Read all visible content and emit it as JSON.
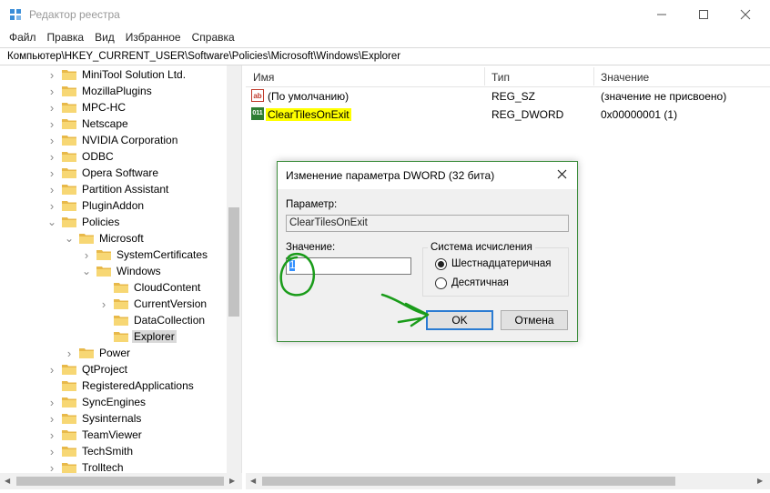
{
  "window": {
    "title": "Редактор реестра",
    "minimize_icon": "minimize-icon",
    "maximize_icon": "maximize-icon",
    "close_icon": "close-icon"
  },
  "menu": [
    {
      "label": "Файл"
    },
    {
      "label": "Правка"
    },
    {
      "label": "Вид"
    },
    {
      "label": "Избранное"
    },
    {
      "label": "Справка"
    }
  ],
  "address": "Компьютер\\HKEY_CURRENT_USER\\Software\\Policies\\Microsoft\\Windows\\Explorer",
  "tree": {
    "items": [
      {
        "label": "MiniTool Solution Ltd.",
        "level": 0,
        "expander": "collapsed"
      },
      {
        "label": "MozillaPlugins",
        "level": 0,
        "expander": "collapsed"
      },
      {
        "label": "MPC-HC",
        "level": 0,
        "expander": "collapsed"
      },
      {
        "label": "Netscape",
        "level": 0,
        "expander": "collapsed"
      },
      {
        "label": "NVIDIA Corporation",
        "level": 0,
        "expander": "collapsed"
      },
      {
        "label": "ODBC",
        "level": 0,
        "expander": "collapsed"
      },
      {
        "label": "Opera Software",
        "level": 0,
        "expander": "collapsed"
      },
      {
        "label": "Partition Assistant",
        "level": 0,
        "expander": "collapsed"
      },
      {
        "label": "PluginAddon",
        "level": 0,
        "expander": "collapsed"
      },
      {
        "label": "Policies",
        "level": 0,
        "expander": "expanded"
      },
      {
        "label": "Microsoft",
        "level": 1,
        "expander": "expanded"
      },
      {
        "label": "SystemCertificates",
        "level": 2,
        "expander": "collapsed"
      },
      {
        "label": "Windows",
        "level": 2,
        "expander": "expanded"
      },
      {
        "label": "CloudContent",
        "level": 3,
        "expander": "none"
      },
      {
        "label": "CurrentVersion",
        "level": 3,
        "expander": "collapsed"
      },
      {
        "label": "DataCollection",
        "level": 3,
        "expander": "none"
      },
      {
        "label": "Explorer",
        "level": 3,
        "expander": "none",
        "selected": true
      },
      {
        "label": "Power",
        "level": 1,
        "expander": "collapsed"
      },
      {
        "label": "QtProject",
        "level": 0,
        "expander": "collapsed"
      },
      {
        "label": "RegisteredApplications",
        "level": 0,
        "expander": "none"
      },
      {
        "label": "SyncEngines",
        "level": 0,
        "expander": "collapsed"
      },
      {
        "label": "Sysinternals",
        "level": 0,
        "expander": "collapsed"
      },
      {
        "label": "TeamViewer",
        "level": 0,
        "expander": "collapsed"
      },
      {
        "label": "TechSmith",
        "level": 0,
        "expander": "collapsed"
      },
      {
        "label": "Trolltech",
        "level": 0,
        "expander": "collapsed"
      }
    ]
  },
  "list": {
    "columns": {
      "name": "Имя",
      "type": "Тип",
      "value": "Значение"
    },
    "rows": [
      {
        "name": "(По умолчанию)",
        "type": "REG_SZ",
        "value": "(значение не присвоено)",
        "icon": "string-value-icon",
        "icon_text": "ab"
      },
      {
        "name": "ClearTilesOnExit",
        "type": "REG_DWORD",
        "value": "0x00000001 (1)",
        "icon": "binary-value-icon",
        "icon_text": "011",
        "highlighted": true
      }
    ]
  },
  "dialog": {
    "title": "Изменение параметра DWORD (32 бита)",
    "param_label": "Параметр:",
    "param_value": "ClearTilesOnExit",
    "value_label": "Значение:",
    "value_input": "1",
    "base_group_label": "Система исчисления",
    "radio_hex": "Шестнадцатеричная",
    "radio_dec": "Десятичная",
    "base_selected": "hex",
    "ok_label": "OK",
    "cancel_label": "Отмена"
  },
  "colors": {
    "highlight": "#ffff00",
    "annotation": "#1a9c1a",
    "selection": "#3390ff",
    "default_button_border": "#2a7bd2"
  }
}
